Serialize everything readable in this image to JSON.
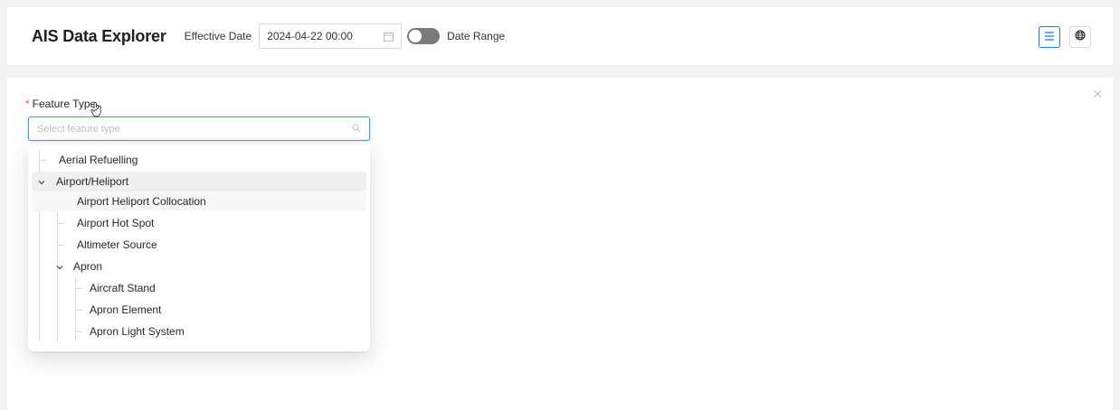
{
  "header": {
    "title": "AIS Data Explorer",
    "effective_date_label": "Effective Date",
    "effective_date_value": "2024-04-22 00:00",
    "date_range_label": "Date Range",
    "date_range_enabled": false,
    "list_view_icon": "list-icon",
    "map_view_icon": "globe-icon",
    "accent_color": "#1677ff"
  },
  "form": {
    "feature_type_label": "Feature Type",
    "required_mark": "*",
    "select_placeholder": "Select feature type",
    "search_icon": "search-icon",
    "close_icon": "close-icon"
  },
  "tree": {
    "items": [
      {
        "label": "Aerial Refuelling",
        "level": 0,
        "expandable": false
      },
      {
        "label": "Airport/Heliport",
        "level": 0,
        "expandable": true,
        "expanded": true
      },
      {
        "label": "Airport Heliport Collocation",
        "level": 1,
        "expandable": false
      },
      {
        "label": "Airport Hot Spot",
        "level": 1,
        "expandable": false
      },
      {
        "label": "Altimeter Source",
        "level": 1,
        "expandable": false
      },
      {
        "label": "Apron",
        "level": 1,
        "expandable": true,
        "expanded": true
      },
      {
        "label": "Aircraft Stand",
        "level": 2,
        "expandable": false
      },
      {
        "label": "Apron Element",
        "level": 2,
        "expandable": false
      },
      {
        "label": "Apron Light System",
        "level": 2,
        "expandable": false
      }
    ]
  }
}
